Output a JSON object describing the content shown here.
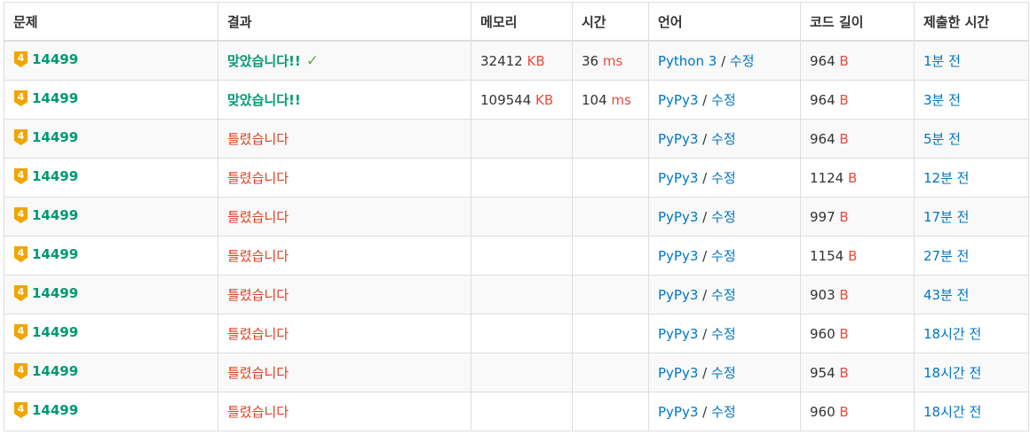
{
  "colors": {
    "accepted": "#009874",
    "wrong": "#dd4124",
    "unit": "#e74c3c",
    "link": "#0076c0",
    "tier_badge": "#f0a500"
  },
  "headers": {
    "problem": "문제",
    "result": "결과",
    "memory": "메모리",
    "time": "시간",
    "language": "언어",
    "code_length": "코드 길이",
    "submitted_at": "제출한 시간"
  },
  "tier_icon": "gold-tier-4-icon",
  "tier_icon_digit": "4",
  "rows": [
    {
      "problem": "14499",
      "result": "맞았습니다!!",
      "status": "accepted",
      "check": "✓",
      "memory": "32412",
      "memory_unit": "KB",
      "time": "36",
      "time_unit": "ms",
      "language": "Python 3",
      "separator": "/",
      "edit": "수정",
      "code_length": "964",
      "length_unit": "B",
      "submitted": "1분 전"
    },
    {
      "problem": "14499",
      "result": "맞았습니다!!",
      "status": "accepted",
      "check": "",
      "memory": "109544",
      "memory_unit": "KB",
      "time": "104",
      "time_unit": "ms",
      "language": "PyPy3",
      "separator": "/",
      "edit": "수정",
      "code_length": "964",
      "length_unit": "B",
      "submitted": "3분 전"
    },
    {
      "problem": "14499",
      "result": "틀렸습니다",
      "status": "wrong",
      "check": "",
      "memory": "",
      "memory_unit": "",
      "time": "",
      "time_unit": "",
      "language": "PyPy3",
      "separator": "/",
      "edit": "수정",
      "code_length": "964",
      "length_unit": "B",
      "submitted": "5분 전"
    },
    {
      "problem": "14499",
      "result": "틀렸습니다",
      "status": "wrong",
      "check": "",
      "memory": "",
      "memory_unit": "",
      "time": "",
      "time_unit": "",
      "language": "PyPy3",
      "separator": "/",
      "edit": "수정",
      "code_length": "1124",
      "length_unit": "B",
      "submitted": "12분 전"
    },
    {
      "problem": "14499",
      "result": "틀렸습니다",
      "status": "wrong",
      "check": "",
      "memory": "",
      "memory_unit": "",
      "time": "",
      "time_unit": "",
      "language": "PyPy3",
      "separator": "/",
      "edit": "수정",
      "code_length": "997",
      "length_unit": "B",
      "submitted": "17분 전"
    },
    {
      "problem": "14499",
      "result": "틀렸습니다",
      "status": "wrong",
      "check": "",
      "memory": "",
      "memory_unit": "",
      "time": "",
      "time_unit": "",
      "language": "PyPy3",
      "separator": "/",
      "edit": "수정",
      "code_length": "1154",
      "length_unit": "B",
      "submitted": "27분 전"
    },
    {
      "problem": "14499",
      "result": "틀렸습니다",
      "status": "wrong",
      "check": "",
      "memory": "",
      "memory_unit": "",
      "time": "",
      "time_unit": "",
      "language": "PyPy3",
      "separator": "/",
      "edit": "수정",
      "code_length": "903",
      "length_unit": "B",
      "submitted": "43분 전"
    },
    {
      "problem": "14499",
      "result": "틀렸습니다",
      "status": "wrong",
      "check": "",
      "memory": "",
      "memory_unit": "",
      "time": "",
      "time_unit": "",
      "language": "PyPy3",
      "separator": "/",
      "edit": "수정",
      "code_length": "960",
      "length_unit": "B",
      "submitted": "18시간 전"
    },
    {
      "problem": "14499",
      "result": "틀렸습니다",
      "status": "wrong",
      "check": "",
      "memory": "",
      "memory_unit": "",
      "time": "",
      "time_unit": "",
      "language": "PyPy3",
      "separator": "/",
      "edit": "수정",
      "code_length": "954",
      "length_unit": "B",
      "submitted": "18시간 전"
    },
    {
      "problem": "14499",
      "result": "틀렸습니다",
      "status": "wrong",
      "check": "",
      "memory": "",
      "memory_unit": "",
      "time": "",
      "time_unit": "",
      "language": "PyPy3",
      "separator": "/",
      "edit": "수정",
      "code_length": "960",
      "length_unit": "B",
      "submitted": "18시간 전"
    }
  ]
}
